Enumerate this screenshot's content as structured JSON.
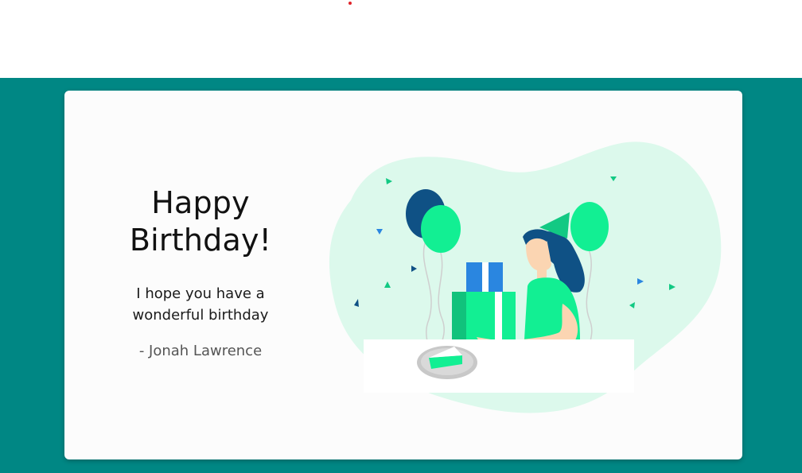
{
  "card": {
    "title_line1": "Happy",
    "title_line2": "Birthday!",
    "message_line1": "I hope you have a",
    "message_line2": "wonderful birthday",
    "signature": "- Jonah Lawrence"
  },
  "colors": {
    "background_band": "#008784",
    "card_bg": "#fcfcfc",
    "accent_green": "#12ef93",
    "dark_green": "#11c27c",
    "navy": "#0f5185",
    "blue": "#2a86e0",
    "mint_blob": "#dcf9ec"
  },
  "illustration": {
    "icon": "birthday-party-illustration"
  }
}
